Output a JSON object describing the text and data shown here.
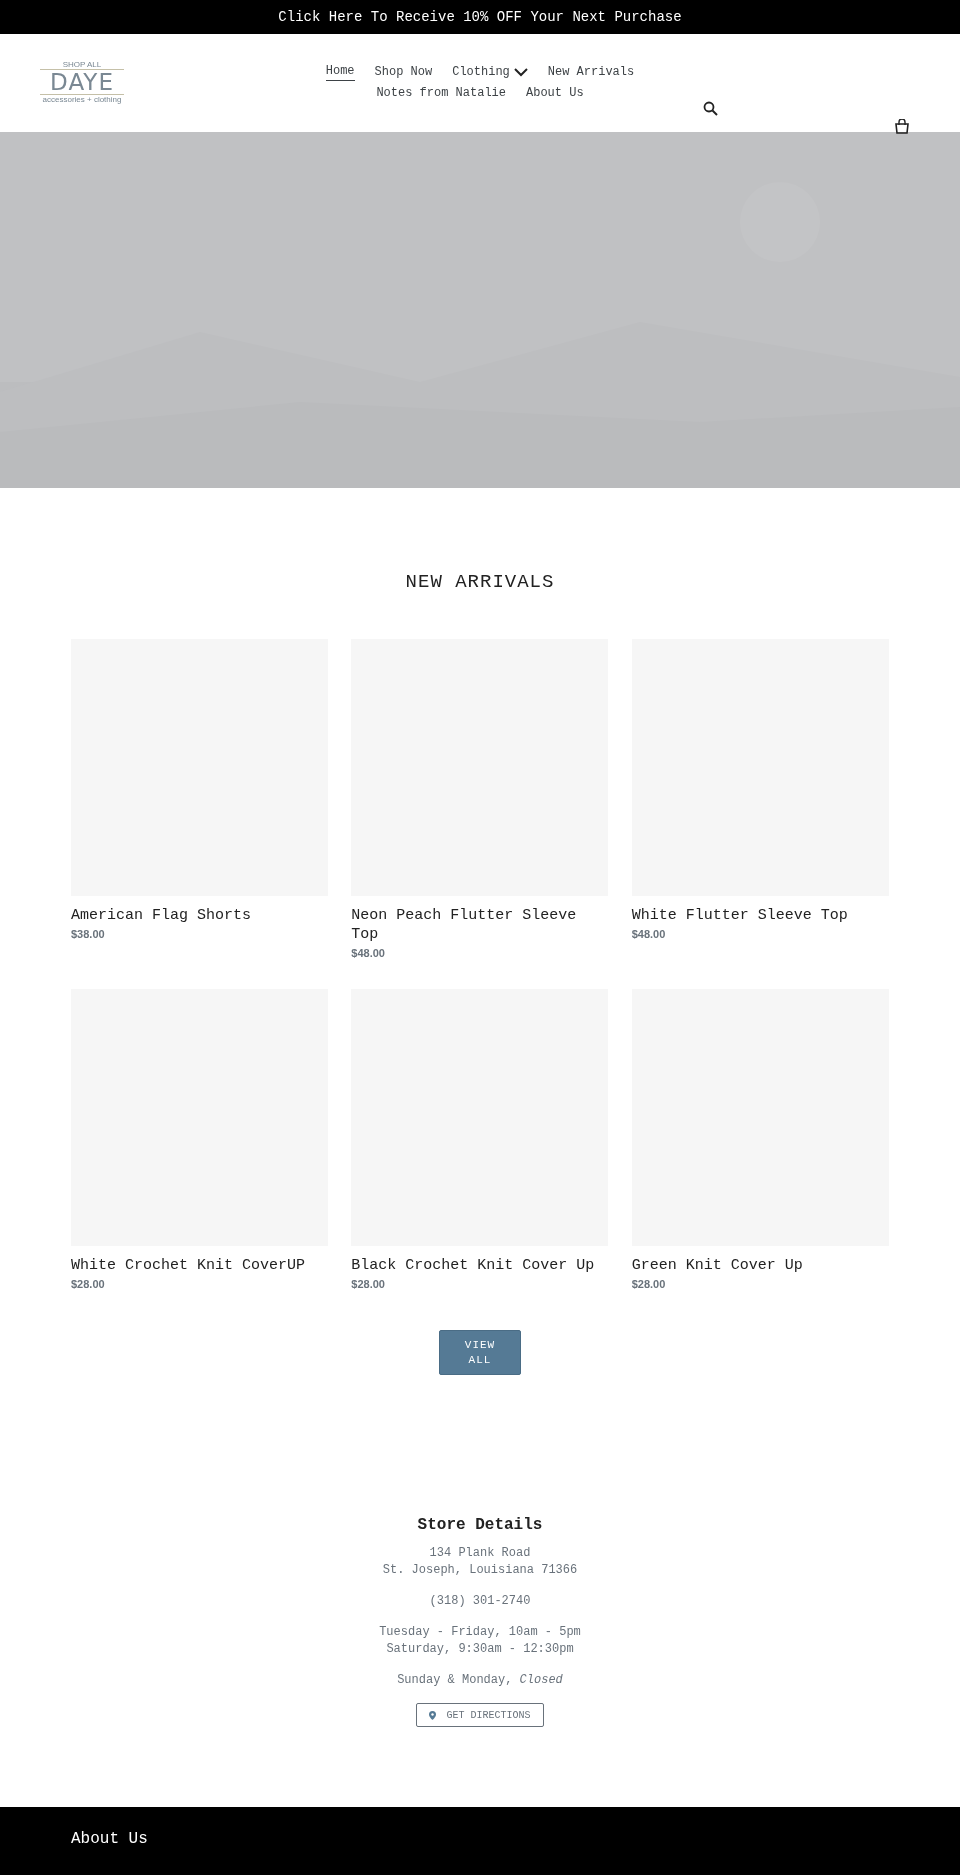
{
  "announcement": "Click Here To Receive 10% OFF Your Next Purchase",
  "logo": {
    "top": "SHOP ALL",
    "name": "DAYE",
    "tagline": "accessories + clothing"
  },
  "nav": [
    {
      "label": "Home",
      "selected": true,
      "dropdown": false
    },
    {
      "label": "Shop Now",
      "selected": false,
      "dropdown": false
    },
    {
      "label": "Clothing",
      "selected": false,
      "dropdown": true
    },
    {
      "label": "New Arrivals",
      "selected": false,
      "dropdown": false
    },
    {
      "label": "Notes from Natalie",
      "selected": false,
      "dropdown": false
    },
    {
      "label": "About Us",
      "selected": false,
      "dropdown": false
    }
  ],
  "section_title": "NEW ARRIVALS",
  "products": [
    {
      "name": "American Flag Shorts",
      "price": "$38.00"
    },
    {
      "name": "Neon Peach Flutter Sleeve Top",
      "price": "$48.00"
    },
    {
      "name": "White Flutter Sleeve Top",
      "price": "$48.00"
    },
    {
      "name": "White Crochet Knit CoverUP",
      "price": "$28.00"
    },
    {
      "name": "Black Crochet Knit Cover Up",
      "price": "$28.00"
    },
    {
      "name": "Green Knit Cover Up",
      "price": "$28.00"
    }
  ],
  "view_all": "VIEW ALL",
  "store": {
    "title": "Store Details",
    "address": [
      "134 Plank Road",
      "St. Joseph, Louisiana 71366"
    ],
    "phone": "(318) 301-2740",
    "hours": [
      "Tuesday - Friday, 10am - 5pm",
      "Saturday, 9:30am - 12:30pm"
    ],
    "closed": "Sunday & Monday, *Closed*",
    "directions": "GET DIRECTIONS"
  },
  "footer": {
    "title": "About Us"
  }
}
